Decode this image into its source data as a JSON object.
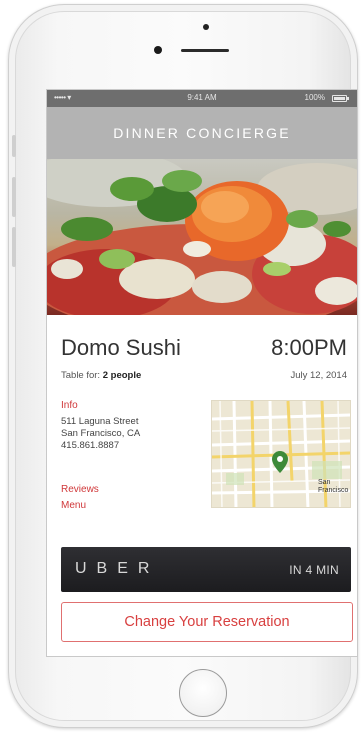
{
  "status_bar": {
    "carrier": "••••• ▾",
    "time": "9:41 AM",
    "battery": "100%"
  },
  "header": {
    "title": "DINNER CONCIERGE"
  },
  "reservation": {
    "restaurant": "Domo Sushi",
    "time": "8:00PM",
    "table_for_label": "Table for:",
    "party_size": "2 people",
    "date": "July 12, 2014"
  },
  "info": {
    "heading": "Info",
    "address_line1": "511 Laguna Street",
    "address_line2": "San Francisco, CA",
    "phone": "415.861.8887",
    "reviews_link": "Reviews",
    "menu_link": "Menu"
  },
  "map": {
    "label_sf": "San",
    "label_sf2": "Francisco",
    "pin_color": "#3d8a3a"
  },
  "uber": {
    "logo": "UBER",
    "eta": "IN 4 MIN"
  },
  "actions": {
    "change_reservation": "Change Your Reservation"
  },
  "colors": {
    "accent_red": "#d0383a",
    "header_gray": "#b3b3b3",
    "uber_dark": "#1c1c1f"
  }
}
